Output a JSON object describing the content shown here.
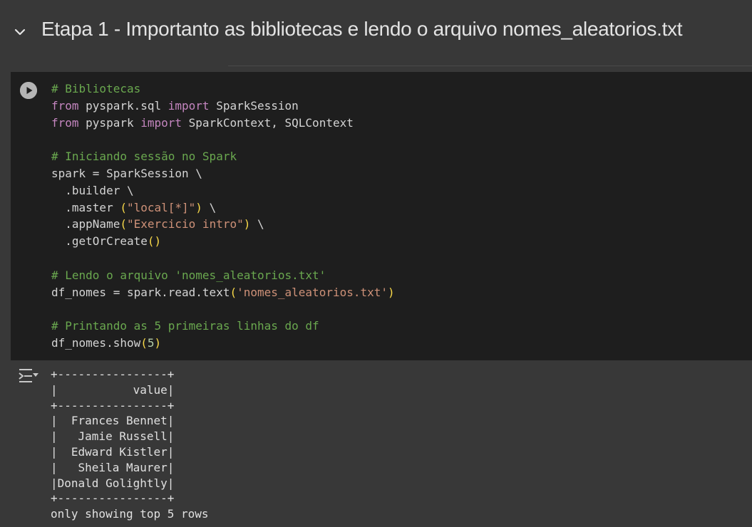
{
  "section": {
    "title": "Etapa 1 - Importanto as bibliotecas e lendo o arquivo nomes_aleatorios.txt",
    "collapse_icon": "chevron-down-icon"
  },
  "code_cell": {
    "run_icon": "play-circle-icon",
    "lines": [
      [
        {
          "t": "comment",
          "v": "# Bibliotecas"
        }
      ],
      [
        {
          "t": "keyword",
          "v": "from"
        },
        {
          "t": "plain",
          "v": " pyspark.sql "
        },
        {
          "t": "keyword",
          "v": "import"
        },
        {
          "t": "plain",
          "v": " SparkSession"
        }
      ],
      [
        {
          "t": "keyword",
          "v": "from"
        },
        {
          "t": "plain",
          "v": " pyspark "
        },
        {
          "t": "keyword",
          "v": "import"
        },
        {
          "t": "plain",
          "v": " SparkContext, SQLContext"
        }
      ],
      [],
      [
        {
          "t": "comment",
          "v": "# Iniciando sessão no Spark"
        }
      ],
      [
        {
          "t": "plain",
          "v": "spark = SparkSession \\"
        }
      ],
      [
        {
          "t": "plain",
          "v": "  .builder \\"
        }
      ],
      [
        {
          "t": "plain",
          "v": "  .master "
        },
        {
          "t": "paren",
          "v": "("
        },
        {
          "t": "string",
          "v": "\"local[*]\""
        },
        {
          "t": "paren",
          "v": ")"
        },
        {
          "t": "plain",
          "v": " \\"
        }
      ],
      [
        {
          "t": "plain",
          "v": "  .appName"
        },
        {
          "t": "paren",
          "v": "("
        },
        {
          "t": "string",
          "v": "\"Exercicio intro\""
        },
        {
          "t": "paren",
          "v": ")"
        },
        {
          "t": "plain",
          "v": " \\"
        }
      ],
      [
        {
          "t": "plain",
          "v": "  .getOrCreate"
        },
        {
          "t": "paren",
          "v": "()"
        }
      ],
      [],
      [
        {
          "t": "comment",
          "v": "# Lendo o arquivo 'nomes_aleatorios.txt'"
        }
      ],
      [
        {
          "t": "plain",
          "v": "df_nomes = spark.read.text"
        },
        {
          "t": "paren",
          "v": "("
        },
        {
          "t": "string",
          "v": "'nomes_aleatorios.txt'"
        },
        {
          "t": "paren",
          "v": ")"
        }
      ],
      [],
      [
        {
          "t": "comment",
          "v": "# Printando as 5 primeiras linhas do df"
        }
      ],
      [
        {
          "t": "plain",
          "v": "df_nomes.show"
        },
        {
          "t": "paren",
          "v": "("
        },
        {
          "t": "number",
          "v": "5"
        },
        {
          "t": "paren",
          "v": ")"
        }
      ]
    ]
  },
  "output": {
    "icon": "output-expand-icon",
    "lines": [
      "+----------------+",
      "|           value|",
      "+----------------+",
      "|  Frances Bennet|",
      "|   Jamie Russell|",
      "|  Edward Kistler|",
      "|   Sheila Maurer|",
      "|Donald Golightly|",
      "+----------------+",
      "only showing top 5 rows"
    ]
  },
  "colors": {
    "background": "#383838",
    "code_background": "#1e1e1e",
    "comment": "#6aa84f",
    "keyword": "#c586c0",
    "string": "#ce9178",
    "paren": "#f9d949"
  }
}
